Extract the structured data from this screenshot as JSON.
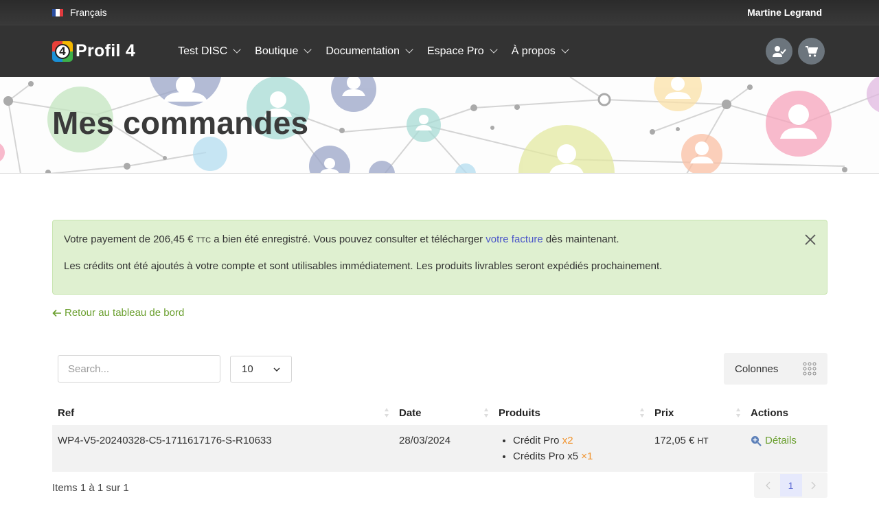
{
  "topbar": {
    "language": "Français",
    "user": "Martine Legrand"
  },
  "brand": {
    "logo_number": "4",
    "name": "Profil 4"
  },
  "nav": {
    "items": [
      {
        "label": "Test DISC"
      },
      {
        "label": "Boutique"
      },
      {
        "label": "Documentation"
      },
      {
        "label": "Espace Pro"
      },
      {
        "label": "À propos"
      }
    ]
  },
  "page": {
    "title": "Mes commandes"
  },
  "alert": {
    "line1_prefix": "Votre payement de 206,45 € ",
    "line1_ttc": "TTC",
    "line1_middle": " a bien été enregistré. Vous pouvez consulter et télécharger ",
    "line1_link": "votre facture",
    "line1_suffix": " dès maintenant.",
    "line2": "Les crédits ont été ajoutés à votre compte et sont utilisables immédiatement. Les produits livrables seront expédiés prochainement."
  },
  "back_link": "Retour au tableau de bord",
  "toolbar": {
    "search_placeholder": "Search...",
    "page_size": "10",
    "columns_label": "Colonnes"
  },
  "table": {
    "headers": [
      "Ref",
      "Date",
      "Produits",
      "Prix",
      "Actions"
    ],
    "rows": [
      {
        "ref": "WP4-V5-20240328-C5-1711617176-S-R10633",
        "date": "28/03/2024",
        "products": [
          {
            "name": "Crédit Pro ",
            "qty": "x2"
          },
          {
            "name": "Crédits Pro x5 ",
            "qty": "×1"
          }
        ],
        "price": "172,05 € ",
        "price_suffix": "HT",
        "action": "Détails"
      }
    ]
  },
  "footer": {
    "items_info": "Items 1 à 1 sur 1",
    "current_page": "1"
  },
  "colors": {
    "accent_green": "#6a9f2e",
    "alert_bg": "#dff0d0",
    "link_blue": "#4a55c8",
    "qty_orange": "#f0922b"
  }
}
